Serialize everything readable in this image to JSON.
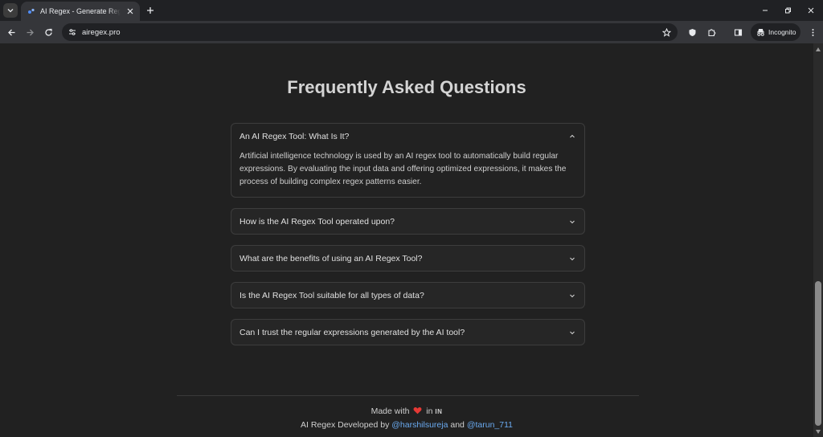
{
  "browser": {
    "tab_title": "AI Regex - Generate Regex Easily",
    "url": "airegex.pro",
    "incognito_label": "Incognito"
  },
  "page": {
    "title": "Frequently Asked Questions",
    "faq": [
      {
        "question": "An AI Regex Tool: What Is It?",
        "answer": "Artificial intelligence technology is used by an AI regex tool to automatically build regular expressions. By evaluating the input data and offering optimized expressions, it makes the process of building complex regex patterns easier.",
        "expanded": true
      },
      {
        "question": "How is the AI Regex Tool operated upon?",
        "expanded": false
      },
      {
        "question": "What are the benefits of using an AI Regex Tool?",
        "expanded": false
      },
      {
        "question": "Is the AI Regex Tool suitable for all types of data?",
        "expanded": false
      },
      {
        "question": "Can I trust the regular expressions generated by the AI tool?",
        "expanded": false
      }
    ],
    "footer": {
      "made_with": "Made with",
      "in": "in",
      "country": "IN",
      "developed_by": "AI Regex Developed by",
      "author1": "@harshilsureja",
      "and": "and",
      "author2": "@tarun_711"
    }
  },
  "colors": {
    "accent_link": "#6aaaf0",
    "heart": "#e53935"
  }
}
